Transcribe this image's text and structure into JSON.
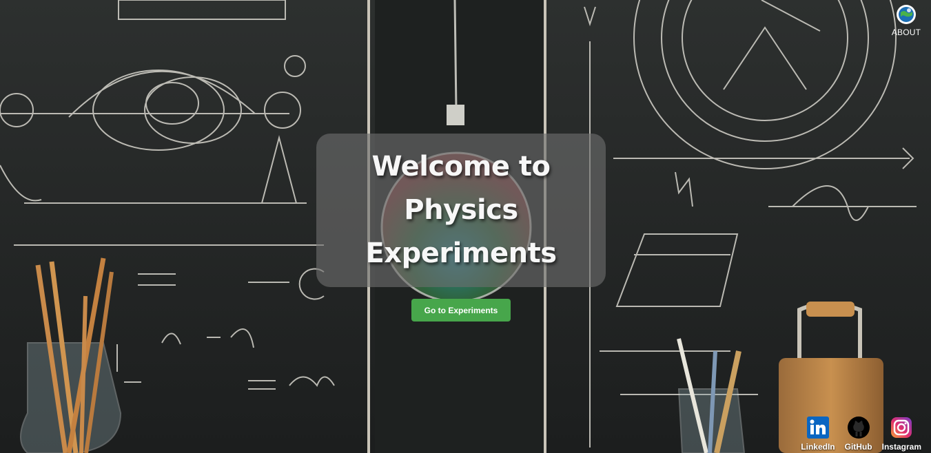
{
  "about": {
    "label": "ABOUT",
    "icon": "globe-icon"
  },
  "hero": {
    "title": "Welcome to Physics Experiments",
    "cta_label": "Go to Experiments"
  },
  "social": [
    {
      "label": "LinkedIn",
      "icon": "linkedin-icon",
      "color": "#0a66c2"
    },
    {
      "label": "GitHub",
      "icon": "github-icon",
      "color": "#000000"
    },
    {
      "label": "Instagram",
      "icon": "instagram-icon",
      "color": "#e1306c"
    }
  ],
  "theme": {
    "background": "#262828",
    "chalk": "#d9d9d2",
    "accent": "#47a64b"
  }
}
